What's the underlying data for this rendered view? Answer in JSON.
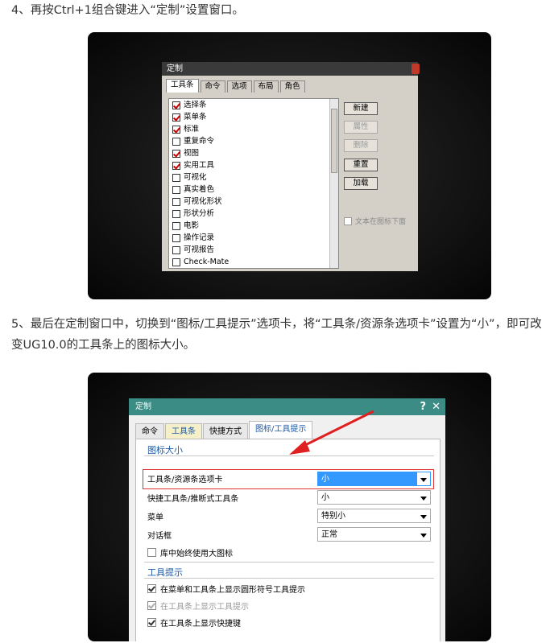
{
  "step4": {
    "text": "4、再按Ctrl+1组合键进入“定制”设置窗口。"
  },
  "step5": {
    "text": "5、最后在定制窗口中，切换到“图标/工具提示”选项卡，将“工具条/资源条选项卡”设置为“小”，即可改变UG10.0的工具条上的图标大小。"
  },
  "dialog1": {
    "title": "定制",
    "tabs": [
      "工具条",
      "命令",
      "选项",
      "布局",
      "角色"
    ],
    "toolbars": [
      {
        "label": "选择条",
        "checked": true
      },
      {
        "label": "菜单条",
        "checked": true
      },
      {
        "label": "标准",
        "checked": true
      },
      {
        "label": "重复命令",
        "checked": false
      },
      {
        "label": "视图",
        "checked": true
      },
      {
        "label": "实用工具",
        "checked": true
      },
      {
        "label": "可视化",
        "checked": false
      },
      {
        "label": "真实着色",
        "checked": false
      },
      {
        "label": "可视化形状",
        "checked": false
      },
      {
        "label": "形状分析",
        "checked": false
      },
      {
        "label": "电影",
        "checked": false
      },
      {
        "label": "操作记录",
        "checked": false
      },
      {
        "label": "可视报告",
        "checked": false
      },
      {
        "label": "Check-Mate",
        "checked": false
      }
    ],
    "buttons": {
      "new": "新建",
      "properties": "属性",
      "delete": "删除",
      "reset": "重置",
      "load": "加载"
    },
    "text_below_icon": "文本在图标下面"
  },
  "dialog2": {
    "title": "定制",
    "help": "?",
    "close": "✕",
    "tabs": [
      "命令",
      "工具条",
      "快捷方式",
      "图标/工具提示"
    ],
    "icon_size": {
      "heading": "图标大小",
      "rows": [
        {
          "label": "工具条/资源条选项卡",
          "value": "小"
        },
        {
          "label": "快捷工具条/推断式工具条",
          "value": "小"
        },
        {
          "label": "菜单",
          "value": "特别小"
        },
        {
          "label": "对话框",
          "value": "正常"
        }
      ],
      "large_icons_label": "库中始终使用大图标"
    },
    "tooltips": {
      "heading": "工具提示",
      "show_symbol_tips": "在菜单和工具条上显示圆形符号工具提示",
      "show_tips": "在工具条上显示工具提示",
      "cut_off": "在工具条上显示快捷键"
    }
  },
  "colors": {
    "title_bar": "#3a8c85",
    "section": "#1d5aa8",
    "highlight": "#d33333",
    "selected": "#3399ff"
  }
}
